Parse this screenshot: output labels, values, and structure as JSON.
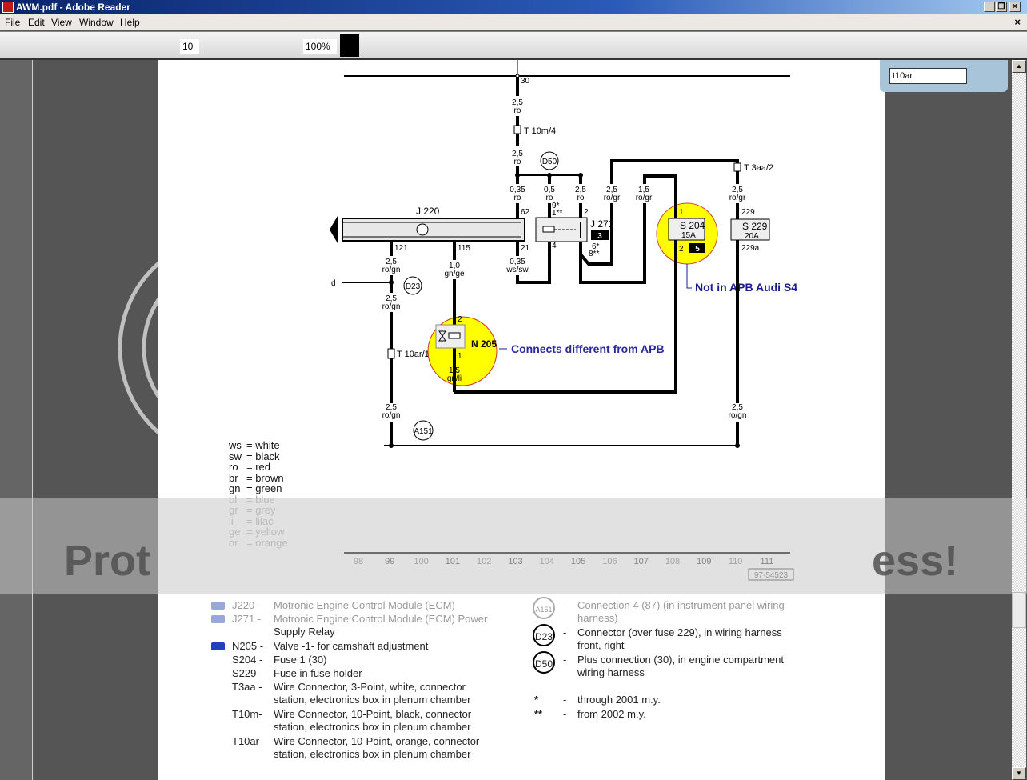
{
  "window": {
    "title": "AWM.pdf - Adobe Reader",
    "buttons": [
      "minimize",
      "restore",
      "close"
    ]
  },
  "menu": {
    "items": [
      "File",
      "Edit",
      "View",
      "Window",
      "Help"
    ],
    "doc_close": "×"
  },
  "toolbar": {
    "page_number": "10",
    "zoom": "100%"
  },
  "find": {
    "value": "t10ar"
  },
  "watermark": {
    "left_text": "Prot",
    "right_text": "ess!"
  },
  "diagram": {
    "top_terminal": "30",
    "connectors": {
      "t10m": "T 10m/4",
      "t3aa": "T 3aa/2",
      "t10ar": "T 10ar/1",
      "d50": "D50",
      "d23": "D23",
      "a151": "A151"
    },
    "wires": {
      "w30_upper": [
        "2,5",
        "ro"
      ],
      "w30_lower": [
        "2,5",
        "ro"
      ],
      "w62": [
        "0,35",
        "ro"
      ],
      "w_relay_in": [
        "0,5",
        "ro"
      ],
      "w_relay_2": [
        "2,5",
        "ro"
      ],
      "w106": [
        "2,5",
        "ro/gr"
      ],
      "w107": [
        "1,5",
        "ro/gr"
      ],
      "w110_top": [
        "2,5",
        "ro/gr"
      ],
      "w121": [
        "2,5",
        "ro/gn"
      ],
      "w115": [
        "1,0",
        "gn/ge"
      ],
      "w21": [
        "0,35",
        "ws/sw"
      ],
      "w99_mid": [
        "2,5",
        "ro/gn"
      ],
      "w99_low": [
        "2,5",
        "ro/gn"
      ],
      "w_n205": [
        "1,5",
        "gn/li"
      ],
      "w110_low": [
        "2,5",
        "ro/gn"
      ]
    },
    "pins": {
      "j220_62": "62",
      "j220_121": "121",
      "j220_115": "115",
      "j220_21": "21",
      "j271_top_left": [
        "9*",
        "1**"
      ],
      "j271_top_right": "2",
      "j271_bottom_left": "4",
      "j271_bottom_right": [
        "6*",
        "8**"
      ],
      "s204_top": "1",
      "s204_bottom": "2",
      "s229_top": "229",
      "s229_bottom": "229a",
      "n205_top": "2",
      "n205_bottom": "1"
    },
    "components": {
      "j220": "J 220",
      "j271": "J 271",
      "j271_badge": "3",
      "s204": [
        "S 204",
        "15A"
      ],
      "s204_badge": "5",
      "s229": [
        "S 229",
        "20A"
      ],
      "n205": "N 205",
      "d_label": "d"
    },
    "annotations": {
      "s204_note": "Not in APB Audi S4",
      "n205_note": "Connects different from APB"
    },
    "ruler": [
      "98",
      "99",
      "100",
      "101",
      "102",
      "103",
      "104",
      "105",
      "106",
      "107",
      "108",
      "109",
      "110",
      "111"
    ],
    "doc_number": "97-54523",
    "highlight_color": "#ffff00",
    "annotation_color": "#1a1a8c"
  },
  "color_legend": [
    {
      "abbr": "ws",
      "name": "white",
      "faded": false
    },
    {
      "abbr": "sw",
      "name": "black",
      "faded": false
    },
    {
      "abbr": "ro",
      "name": "red",
      "faded": false
    },
    {
      "abbr": "br",
      "name": "brown",
      "faded": false
    },
    {
      "abbr": "gn",
      "name": "green",
      "faded": false
    },
    {
      "abbr": "bl",
      "name": "blue",
      "faded": true
    },
    {
      "abbr": "gr",
      "name": "grey",
      "faded": true
    },
    {
      "abbr": "li",
      "name": "lilac",
      "faded": true
    },
    {
      "abbr": "ge",
      "name": "yellow",
      "faded": true
    },
    {
      "abbr": "or",
      "name": "orange",
      "faded": true
    }
  ],
  "parts_legend": [
    {
      "code": "J220 -",
      "text": "Motronic Engine Control Module (ECM)",
      "icon": "camera-icon",
      "faded": true
    },
    {
      "code": "J271 -",
      "text": "Motronic Engine Control Module (ECM) Power",
      "text2": "Supply Relay",
      "icon": "camera-icon",
      "faded": true
    },
    {
      "code": "N205 -",
      "text": "Valve -1- for camshaft adjustment",
      "icon": "camera-icon",
      "faded": false
    },
    {
      "code": "S204 -",
      "text": "Fuse 1 (30)"
    },
    {
      "code": "S229 -",
      "text": "Fuse in fuse holder"
    },
    {
      "code": "T3aa -",
      "text": "Wire Connector, 3-Point, white, connector",
      "text2": "station, electronics box in plenum chamber"
    },
    {
      "code": "T10m-",
      "text": "Wire Connector, 10-Point, black, connector",
      "text2": "station, electronics box in plenum chamber"
    },
    {
      "code": "T10ar-",
      "text": "Wire Connector, 10-Point, orange, connector",
      "text2": "station, electronics box in plenum chamber"
    }
  ],
  "connections_legend": [
    {
      "code": "A151",
      "text": "Connection 4 (87) (in instrument panel wiring",
      "text2": "harness)",
      "faded": true
    },
    {
      "code": "D23",
      "text": "Connector (over fuse 229), in wiring harness",
      "text2": "front, right"
    },
    {
      "code": "D50",
      "text": "Plus connection (30), in engine compartment",
      "text2": "wiring harness"
    }
  ],
  "footnotes": [
    {
      "mark": "*",
      "text": "through 2001 m.y."
    },
    {
      "mark": "**",
      "text": "from 2002 m.y."
    }
  ]
}
